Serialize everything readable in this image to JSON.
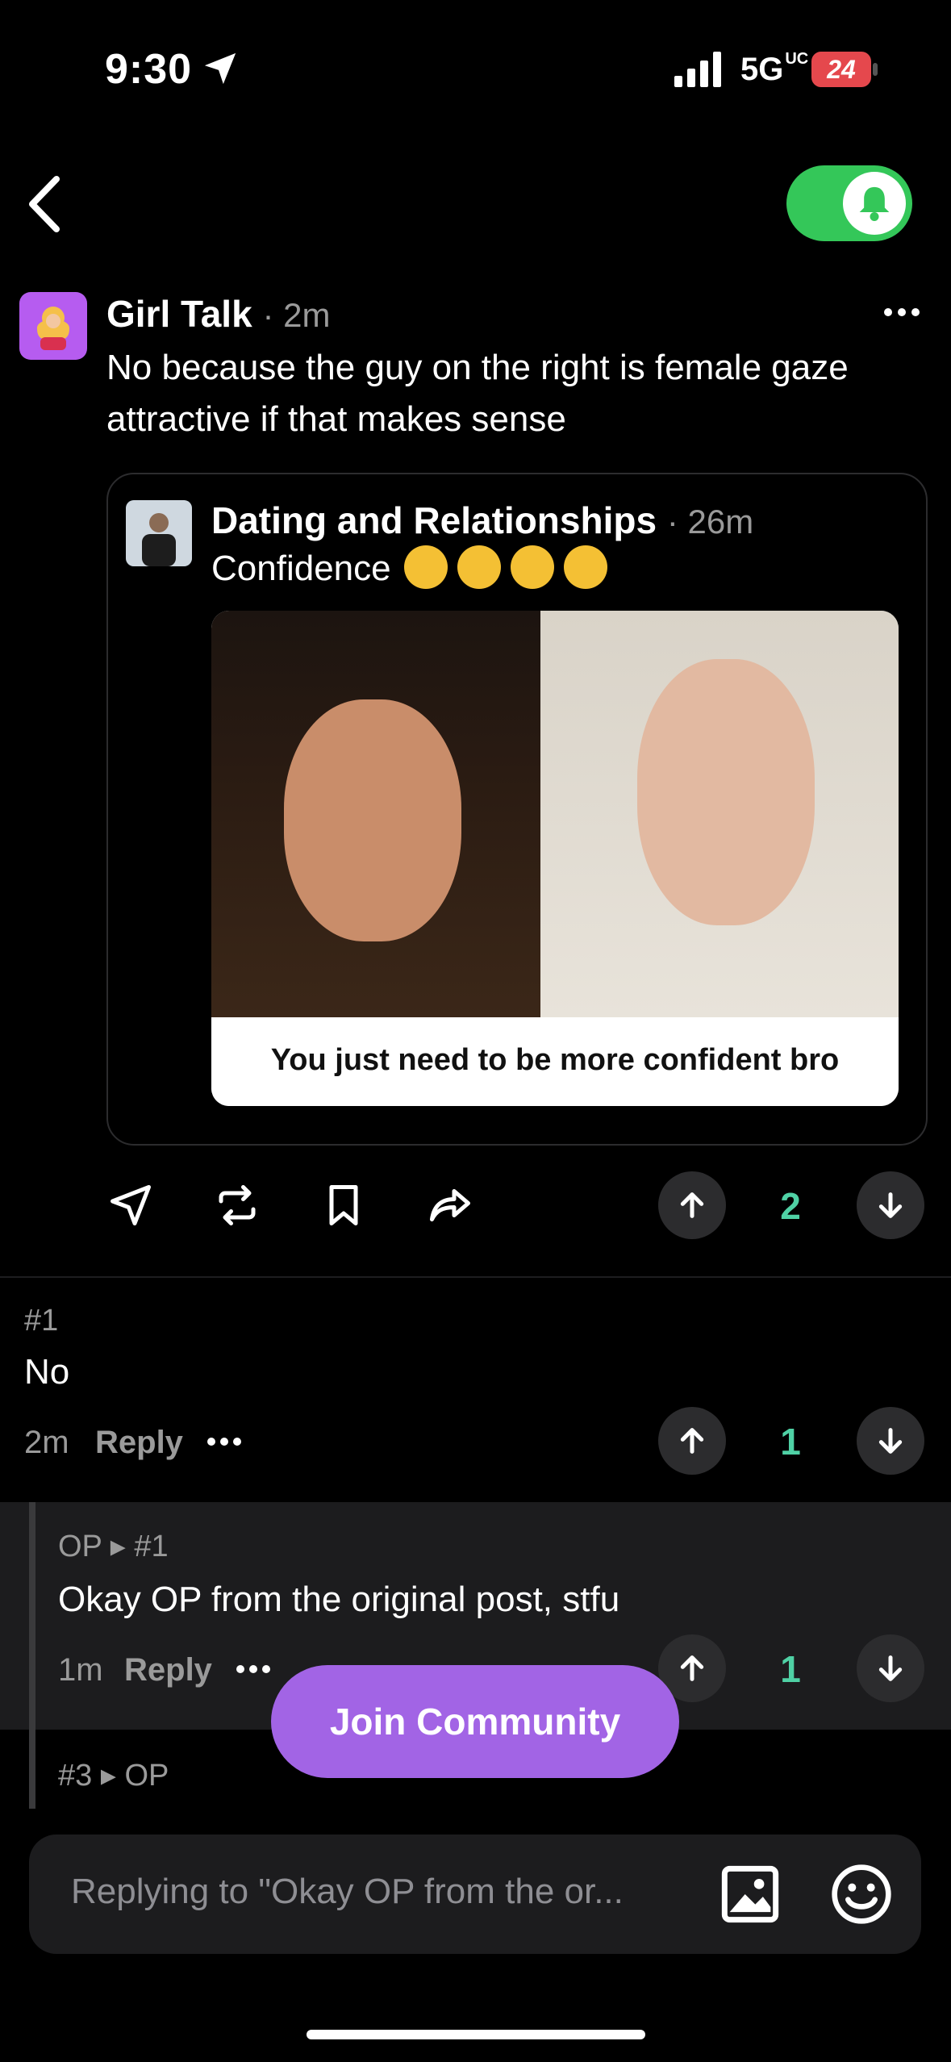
{
  "status_bar": {
    "time": "9:30",
    "network": "5G",
    "network_sup": "UC",
    "battery": "24"
  },
  "post": {
    "community": "Girl Talk",
    "age": "· 2m",
    "text": "No because the guy on the right is female gaze attractive if that makes sense",
    "quoted": {
      "community": "Dating and Relationships",
      "age": "· 26m",
      "text": "Confidence",
      "meme_caption": "You just need to be more confident bro"
    },
    "score": "2"
  },
  "comments": [
    {
      "num": "#1",
      "text": "No",
      "age": "2m",
      "reply": "Reply",
      "score": "1"
    },
    {
      "num": "OP ▸ #1",
      "text": "Okay OP from the original post, stfu",
      "age": "1m",
      "reply": "Reply",
      "score": "1"
    },
    {
      "num": "#3 ▸ OP"
    }
  ],
  "join_label": "Join Community",
  "input": {
    "placeholder": "Replying to \"Okay OP from the or..."
  },
  "colors": {
    "accent": "#a264e5",
    "score": "#4fd1a5",
    "toggle": "#34c759"
  }
}
